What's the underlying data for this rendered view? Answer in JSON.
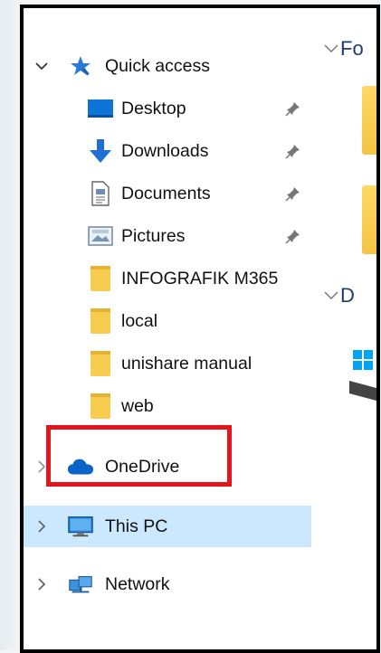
{
  "colors": {
    "selection": "#cce8ff",
    "highlight": "#e8141b",
    "folder_yellow": "#f8cc4f",
    "onedrive_blue": "#0a64c8",
    "accent_blue": "#1b74d2"
  },
  "nav": {
    "quick_access": {
      "label": "Quick access",
      "icon": "star-icon",
      "expanded": true,
      "items": [
        {
          "label": "Desktop",
          "icon": "desktop-icon",
          "pinned": true
        },
        {
          "label": "Downloads",
          "icon": "download-arrow-icon",
          "pinned": true
        },
        {
          "label": "Documents",
          "icon": "document-icon",
          "pinned": true
        },
        {
          "label": "Pictures",
          "icon": "pictures-icon",
          "pinned": true
        },
        {
          "label": "INFOGRAFIK M365",
          "icon": "folder-icon",
          "pinned": false
        },
        {
          "label": "local",
          "icon": "folder-icon",
          "pinned": false
        },
        {
          "label": "unishare manual",
          "icon": "folder-icon",
          "pinned": false
        },
        {
          "label": "web",
          "icon": "folder-icon",
          "pinned": false
        }
      ]
    },
    "onedrive": {
      "label": "OneDrive",
      "icon": "cloud-icon",
      "highlighted": true
    },
    "this_pc": {
      "label": "This PC",
      "icon": "monitor-icon",
      "selected": true
    },
    "network": {
      "label": "Network",
      "icon": "network-icon"
    }
  },
  "content": {
    "sections": [
      {
        "label_fragment": "Fo",
        "icon": "chevron-down-icon"
      },
      {
        "label_fragment": "D",
        "icon": "chevron-down-icon"
      }
    ]
  }
}
